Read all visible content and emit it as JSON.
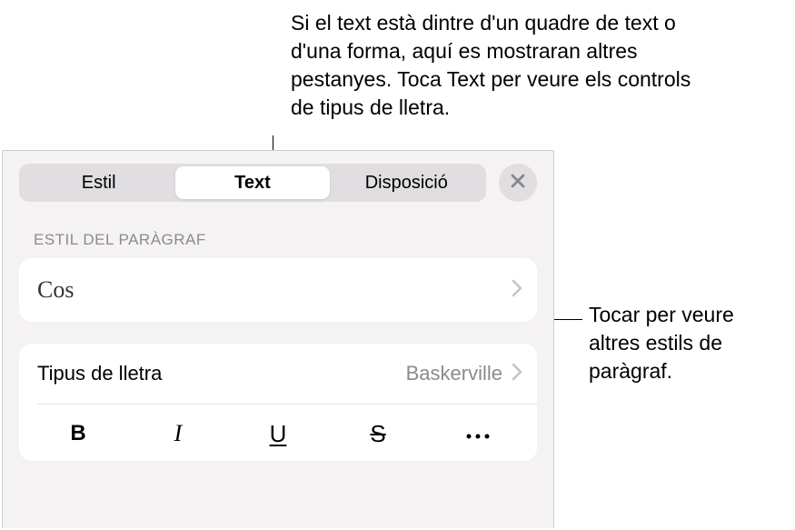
{
  "callouts": {
    "top": "Si el text està dintre d'un quadre de text o d'una forma, aquí es mostraran altres pestanyes. Toca Text per veure els controls de tipus de lletra.",
    "right": "Tocar per veure altres estils de paràgraf."
  },
  "tabs": {
    "style": "Estil",
    "text": "Text",
    "layout": "Disposició"
  },
  "paragraph_style": {
    "heading": "ESTIL DEL PARÀGRAF",
    "value": "Cos"
  },
  "font": {
    "label": "Tipus de lletra",
    "value": "Baskerville"
  },
  "style_buttons": {
    "bold": "B",
    "italic": "I",
    "underline": "U",
    "strike": "S"
  }
}
